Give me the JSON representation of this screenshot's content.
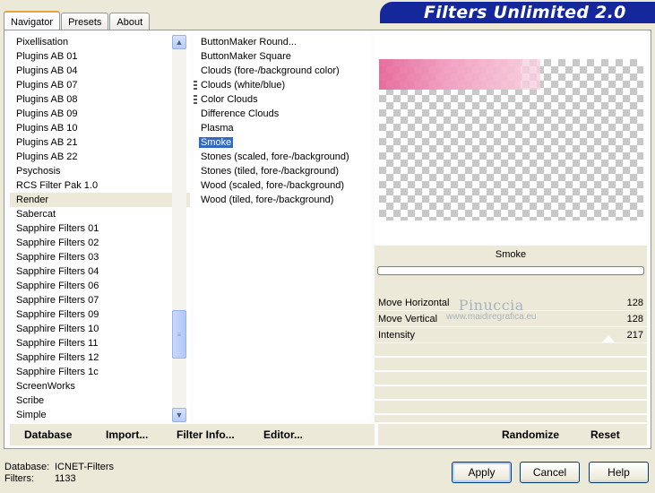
{
  "tabs": [
    "Navigator",
    "Presets",
    "About"
  ],
  "banner": "Filters Unlimited 2.0",
  "categories": [
    "Pixellisation",
    "Plugins AB 01",
    "Plugins AB 04",
    "Plugins AB 07",
    "Plugins AB 08",
    "Plugins AB 09",
    "Plugins AB 10",
    "Plugins AB 21",
    "Plugins AB 22",
    "Psychosis",
    "RCS Filter Pak 1.0",
    "Render",
    "Sabercat",
    "Sapphire Filters 01",
    "Sapphire Filters 02",
    "Sapphire Filters 03",
    "Sapphire Filters 04",
    "Sapphire Filters 06",
    "Sapphire Filters 07",
    "Sapphire Filters 09",
    "Sapphire Filters 10",
    "Sapphire Filters 11",
    "Sapphire Filters 12",
    "Sapphire Filters 1c",
    "ScreenWorks",
    "Scribe",
    "Simple"
  ],
  "selected_category": "Render",
  "filters": [
    "ButtonMaker Round...",
    "ButtonMaker Square",
    "Clouds (fore-/background color)",
    "Clouds (white/blue)",
    "Color Clouds",
    "Difference Clouds",
    "Plasma",
    "Smoke",
    "Stones (scaled, fore-/background)",
    "Stones (tiled, fore-/background)",
    "Wood (scaled, fore-/background)",
    "Wood (tiled, fore-/background)"
  ],
  "selected_filter": "Smoke",
  "preview": {
    "filter_name": "Smoke"
  },
  "parameters": [
    {
      "label": "Move Horizontal",
      "value": "128"
    },
    {
      "label": "Move Vertical",
      "value": "128"
    },
    {
      "label": "Intensity",
      "value": "217"
    }
  ],
  "watermark": {
    "name": "Pinuccia",
    "url": "www.maidiregrafica.eu"
  },
  "toolbar": {
    "database": "Database",
    "import": "Import...",
    "filter_info": "Filter Info...",
    "editor": "Editor...",
    "randomize": "Randomize",
    "reset": "Reset"
  },
  "footer": {
    "database_label": "Database:",
    "database_value": "ICNET-Filters",
    "filters_label": "Filters:",
    "filters_value": "1133"
  },
  "buttons": {
    "apply": "Apply",
    "cancel": "Cancel",
    "help": "Help"
  }
}
